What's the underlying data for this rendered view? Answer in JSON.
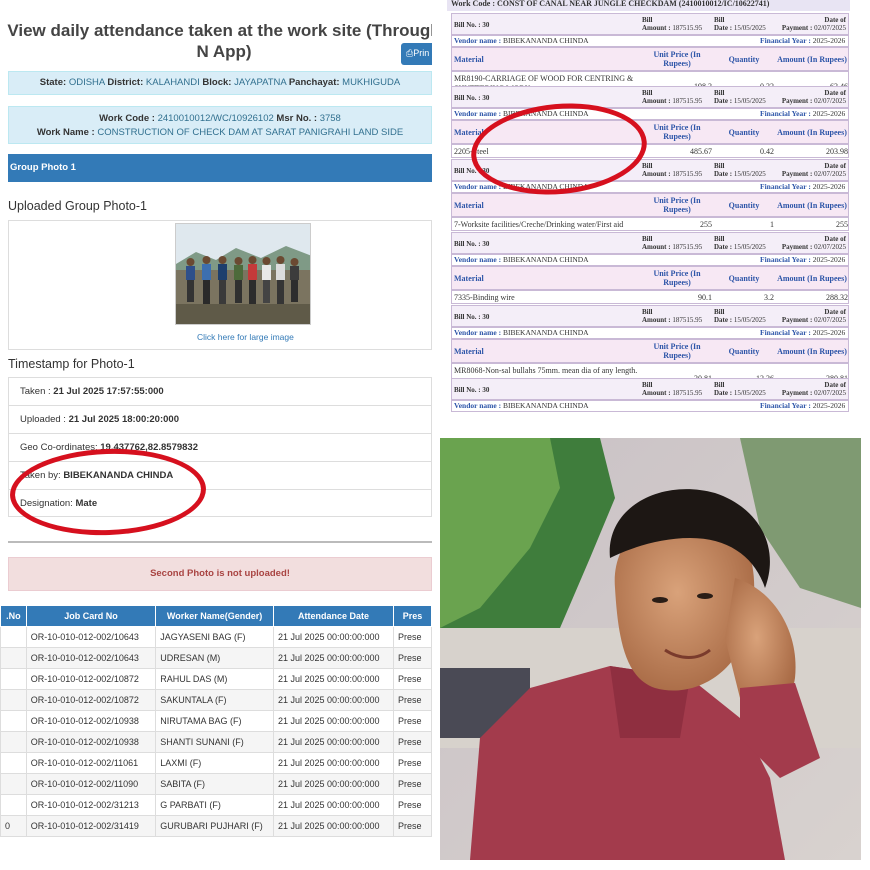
{
  "left": {
    "title": "View daily attendance taken at the work site (Through N App)",
    "print_label": "Prin",
    "location": {
      "state_label": "State:",
      "state": "ODISHA",
      "district_label": "District:",
      "district": "KALAHANDI",
      "block_label": "Block:",
      "block": "JAYAPATNA",
      "panchayat_label": "Panchayat:",
      "panchayat": "MUKHIGUDA"
    },
    "work": {
      "code_label": "Work Code :",
      "code": "2410010012/WC/10926102",
      "msr_label": "Msr No. :",
      "msr": "3758",
      "name_label": "Work Name :",
      "name": "CONSTRUCTION OF CHECK DAM AT SARAT PANIGRAHI LAND SIDE"
    },
    "group_photo_header": "Group Photo 1",
    "uploaded_title": "Uploaded Group Photo-1",
    "photo_link": "Click here for large image",
    "timestamp_title": "Timestamp for Photo-1",
    "timestamp": {
      "taken_label": "Taken :",
      "taken": "21 Jul 2025 17:57:55:000",
      "uploaded_label": "Uploaded :",
      "uploaded": "21 Jul 2025 18:00:20:000",
      "geo_label": "Geo Co-ordinates:",
      "geo": "19.437762,82.8579832",
      "taken_by_label": "Taken by:",
      "taken_by": "BIBEKANANDA CHINDA",
      "designation_label": "Designation:",
      "designation": "Mate"
    },
    "alert": "Second Photo is not uploaded!",
    "table": {
      "headers": [
        ".No",
        "Job Card No",
        "Worker Name(Gender)",
        "Attendance Date",
        "Pres"
      ],
      "rows": [
        [
          "",
          "OR-10-010-012-002/10643",
          "JAGYASENI BAG (F)",
          "21 Jul 2025 00:00:00:000",
          "Prese"
        ],
        [
          "",
          "OR-10-010-012-002/10643",
          "UDRESAN (M)",
          "21 Jul 2025 00:00:00:000",
          "Prese"
        ],
        [
          "",
          "OR-10-010-012-002/10872",
          "RAHUL DAS (M)",
          "21 Jul 2025 00:00:00:000",
          "Prese"
        ],
        [
          "",
          "OR-10-010-012-002/10872",
          "SAKUNTALA (F)",
          "21 Jul 2025 00:00:00:000",
          "Prese"
        ],
        [
          "",
          "OR-10-010-012-002/10938",
          "NIRUTAMA BAG (F)",
          "21 Jul 2025 00:00:00:000",
          "Prese"
        ],
        [
          "",
          "OR-10-010-012-002/10938",
          "SHANTI SUNANI (F)",
          "21 Jul 2025 00:00:00:000",
          "Prese"
        ],
        [
          "",
          "OR-10-010-012-002/11061",
          "LAXMI (F)",
          "21 Jul 2025 00:00:00:000",
          "Prese"
        ],
        [
          "",
          "OR-10-010-012-002/11090",
          "SABITA (F)",
          "21 Jul 2025 00:00:00:000",
          "Prese"
        ],
        [
          "",
          "OR-10-010-012-002/31213",
          "G PARBATI (F)",
          "21 Jul 2025 00:00:00:000",
          "Prese"
        ],
        [
          "0",
          "OR-10-010-012-002/31419",
          "GURUBARI PUJHARI (F)",
          "21 Jul 2025 00:00:00:000",
          "Prese"
        ]
      ]
    }
  },
  "right": {
    "header": "Work Code : CONST OF CANAL NEAR JUNGLE CHECKDAM (2410010012/IC/10622741)",
    "labels": {
      "bill_no": "Bill No. :",
      "bill": "Bill",
      "amount": "Amount :",
      "date": "Date :",
      "date_of": "Date of",
      "payment": "Payment :",
      "vendor_name": "Vendor name :",
      "financial_year": "Financial Year :",
      "material": "Material",
      "unit_price": "Unit Price (In Rupees)",
      "quantity": "Quantity",
      "amount_col": "Amount (In Rupees)"
    },
    "bill_no": "30",
    "bill_amount": "187515.95",
    "bill_date": "15/05/2025",
    "payment_date": "02/07/2025",
    "vendor": "BIBEKANANDA CHINDA",
    "financial_year": "2025-2026",
    "items": [
      {
        "material": "MR8190-CARRIAGE OF WOOD FOR CENTRING & SHUTTERING WORK",
        "unit_price": "198.3",
        "quantity": "0.32",
        "amount": "63.46"
      },
      {
        "material": "2205-Steel",
        "unit_price": "485.67",
        "quantity": "0.42",
        "amount": "203.98"
      },
      {
        "material": "7-Worksite facilities/Creche/Drinking water/First aid",
        "unit_price": "255",
        "quantity": "1",
        "amount": "255"
      },
      {
        "material": "7335-Binding wire",
        "unit_price": "90.1",
        "quantity": "3.2",
        "amount": "288.32"
      },
      {
        "material": "MR8068-Non-sal bullahs 75mm. mean dia of any length.",
        "unit_price": "30.81",
        "quantity": "12.36",
        "amount": "380.81"
      }
    ]
  }
}
